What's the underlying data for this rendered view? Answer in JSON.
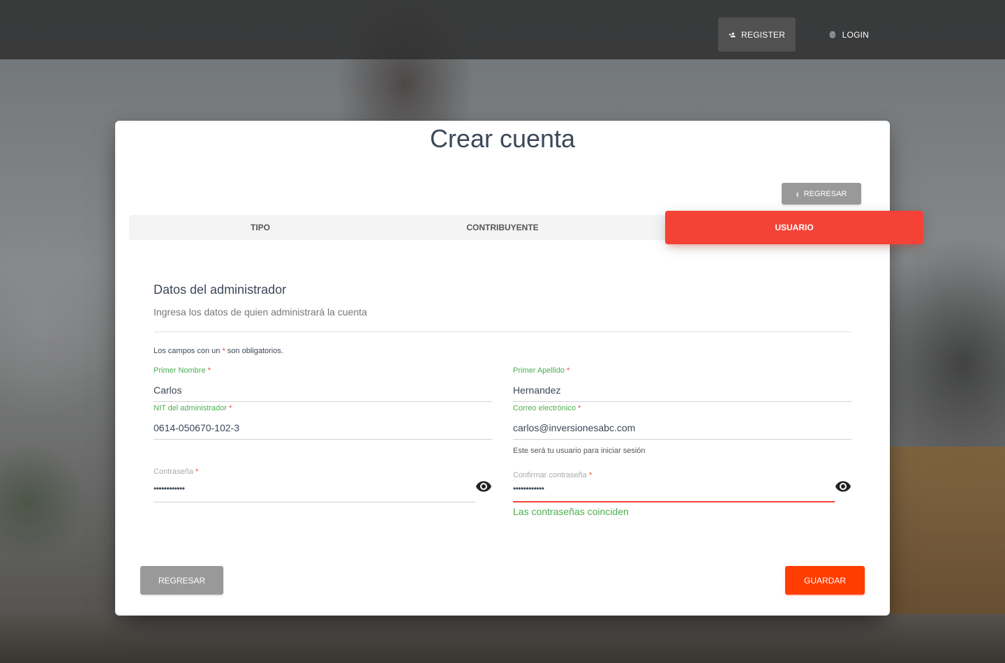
{
  "nav": {
    "register_label": "REGISTER",
    "login_label": "LOGIN"
  },
  "card": {
    "title": "Crear cuenta",
    "back_top_label": "REGRESAR"
  },
  "tabs": [
    {
      "label": "TIPO",
      "active": false
    },
    {
      "label": "CONTRIBUYENTE",
      "active": false
    },
    {
      "label": "USUARIO",
      "active": true
    }
  ],
  "section": {
    "title": "Datos del administrador",
    "subtitle": "Ingresa los datos de quien administrará la cuenta",
    "required_note_prefix": "Los campos con un",
    "required_mark": "*",
    "required_note_suffix": "son obligatorios."
  },
  "form": {
    "first_name": {
      "label": "Primer Nombre",
      "value": "Carlos"
    },
    "last_name": {
      "label": "Primer Apellido",
      "value": "Hernandez"
    },
    "nit": {
      "label": "NIT del administrador",
      "value": "0614-050670-102-3"
    },
    "email": {
      "label": "Correo electrónico",
      "value": "carlos@inversionesabc.com",
      "help": "Este será tu usuario para iniciar sesión"
    },
    "password": {
      "label": "Contraseña",
      "value": "••••••••••••"
    },
    "confirm_password": {
      "label": "Confirmar contraseña",
      "value": "••••••••••••",
      "status": "Las contraseñas coinciden"
    }
  },
  "footer": {
    "back_label": "REGRESAR",
    "save_label": "GUARDAR"
  },
  "colors": {
    "accent_red": "#f44336",
    "save_orange": "#ff3d00",
    "success_green": "#4caf50",
    "neutral_button": "#999999"
  },
  "icons": [
    "person-add-icon",
    "fingerprint-icon",
    "chevron-left-icon",
    "eye-icon"
  ]
}
